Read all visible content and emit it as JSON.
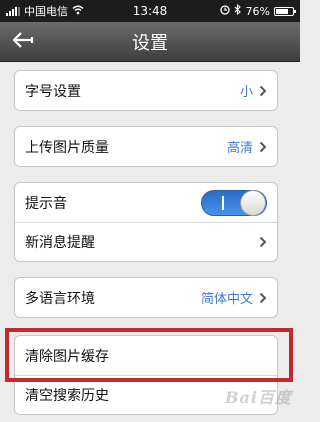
{
  "status_bar": {
    "carrier": "中国电信",
    "time": "13:48",
    "battery_text": "76%",
    "battery_level": 0.76
  },
  "nav": {
    "title": "设置",
    "back_icon": "back-arrow-icon"
  },
  "settings": {
    "font_size": {
      "label": "字号设置",
      "value": "小"
    },
    "upload_quality": {
      "label": "上传图片质量",
      "value": "高清"
    },
    "sound": {
      "label": "提示音",
      "enabled": true
    },
    "new_message_alert": {
      "label": "新消息提醒"
    },
    "language": {
      "label": "多语言环境",
      "value": "简体中文"
    },
    "clear_image_cache": {
      "label": "清除图片缓存"
    },
    "clear_search_history": {
      "label": "清空搜索历史"
    }
  },
  "colors": {
    "accent": "#3d7bc7",
    "toggle_on": "#2a6cc6",
    "highlight": "#c22a31"
  },
  "watermark": "Bai百度"
}
